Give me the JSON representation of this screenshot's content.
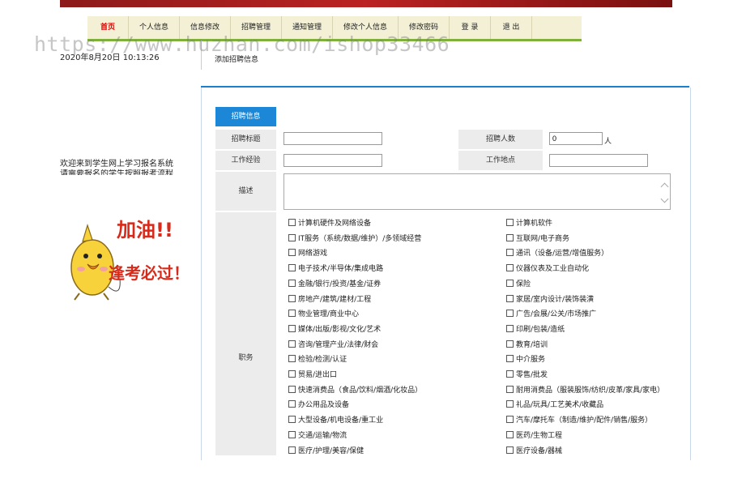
{
  "nav": {
    "items": [
      {
        "label": "首页",
        "active": true
      },
      {
        "label": "个人信息"
      },
      {
        "label": "信息修改"
      },
      {
        "label": "招聘管理"
      },
      {
        "label": "通知管理"
      },
      {
        "label": "修改个人信息"
      },
      {
        "label": "修改密码"
      },
      {
        "label": "登 录"
      },
      {
        "label": "退 出"
      }
    ]
  },
  "watermark": "https://www.huzhan.com/ishop33466",
  "datetime": "2020年8月20日  10:13:26",
  "page_title": "添加招聘信息",
  "sidebar": {
    "welcome_line1": "欢迎来到学生网上学习报名系统",
    "welcome_line2": "请需要报名的学生按照报考流程",
    "mascot_text1": "加油!!",
    "mascot_text2": "逢考必过！"
  },
  "form": {
    "tab_label": "招聘信息",
    "title_label": "招聘标题",
    "title_value": "",
    "count_label": "招聘人数",
    "count_value": "0",
    "count_unit": "人",
    "experience_label": "工作经验",
    "experience_value": "",
    "location_label": "工作地点",
    "location_value": "",
    "desc_label": "描述",
    "category_label": "职务",
    "categories_left": [
      "计算机硬件及网络设备",
      "IT服务（系统/数据/维护）/多领域经营",
      "网络游戏",
      "电子技术/半导体/集成电路",
      "金融/银行/投资/基金/证券",
      "房地产/建筑/建材/工程",
      "物业管理/商业中心",
      "媒体/出版/影视/文化/艺术",
      "咨询/管理产业/法律/财会",
      "检验/检测/认证",
      "贸易/进出口",
      "快速消费品（食品/饮料/烟酒/化妆品）",
      "办公用品及设备",
      "大型设备/机电设备/重工业",
      "交通/运输/物流",
      "医疗/护理/美容/保健"
    ],
    "categories_right": [
      "计算机软件",
      "互联网/电子商务",
      "通讯（设备/运营/增值服务）",
      "仪器仪表及工业自动化",
      "保险",
      "家居/室内设计/装饰装潢",
      "广告/会展/公关/市场推广",
      "印刷/包装/造纸",
      "教育/培训",
      "中介服务",
      "零售/批发",
      "耐用消费品（服装服饰/纺织/皮革/家具/家电）",
      "礼品/玩具/工艺美术/收藏品",
      "汽车/摩托车（制造/维护/配件/销售/服务）",
      "医药/生物工程",
      "医疗设备/器械"
    ]
  },
  "colors": {
    "banner": "#9b1c1c",
    "nav_bg": "#f3f0d6",
    "nav_underline": "#7fb13a",
    "nav_active": "#dd0000",
    "accent_blue": "#1b87d6",
    "label_bg": "#ececec"
  }
}
